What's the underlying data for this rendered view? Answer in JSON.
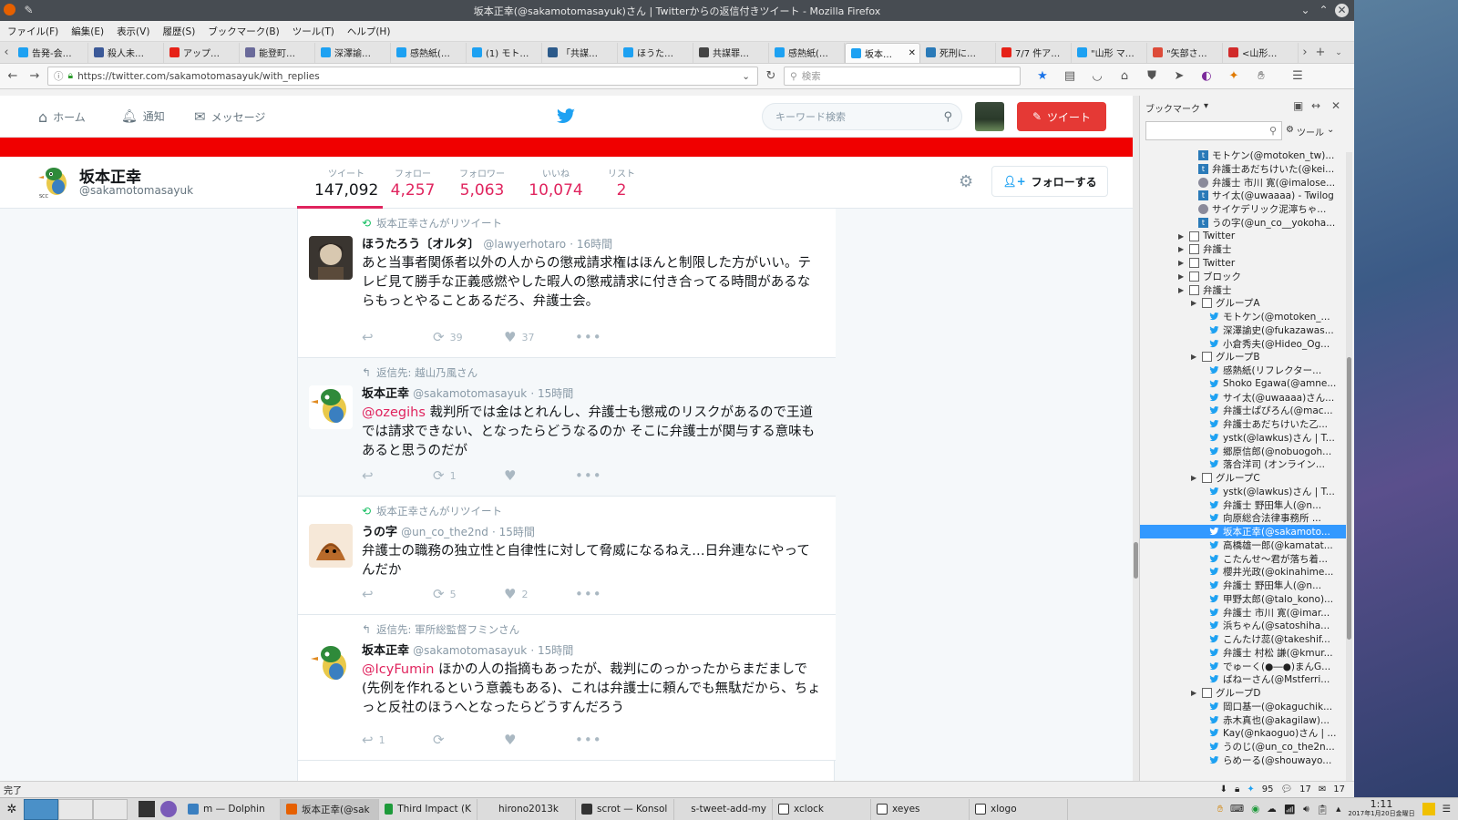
{
  "window": {
    "title": "坂本正幸(@sakamotomasayuk)さん | Twitterからの返信付きツイート - Mozilla Firefox"
  },
  "menu": [
    "ファイル(F)",
    "編集(E)",
    "表示(V)",
    "履歴(S)",
    "ブックマーク(B)",
    "ツール(T)",
    "ヘルプ(H)"
  ],
  "tabs": [
    {
      "label": "告発-会…",
      "icon": "twitter-icon",
      "color": "#1da1f2"
    },
    {
      "label": "殺人未…",
      "icon": "facebook-icon",
      "color": "#3b5998"
    },
    {
      "label": "アップ…",
      "icon": "youtube-icon",
      "color": "#e62117"
    },
    {
      "label": "能登町…",
      "icon": "globe-icon",
      "color": "#6a6a9a"
    },
    {
      "label": "深澤諭…",
      "icon": "twitter-icon",
      "color": "#1da1f2"
    },
    {
      "label": "感熱紙(…",
      "icon": "twitter-icon",
      "color": "#1da1f2"
    },
    {
      "label": "(1) モト…",
      "icon": "twitter-icon",
      "color": "#1da1f2"
    },
    {
      "label": "「共謀…",
      "icon": "arrow-icon",
      "color": "#2c5a8a"
    },
    {
      "label": "ほうた…",
      "icon": "twitter-icon",
      "color": "#1da1f2"
    },
    {
      "label": "共謀罪…",
      "icon": "spider-icon",
      "color": "#444"
    },
    {
      "label": "感熱紙(…",
      "icon": "twitter-icon",
      "color": "#1da1f2"
    },
    {
      "label": "坂本…",
      "icon": "twitter-icon",
      "color": "#1da1f2",
      "active": true
    },
    {
      "label": "死刑に…",
      "icon": "grid-icon",
      "color": "#2a7ab8"
    },
    {
      "label": "7/7 件ア…",
      "icon": "youtube-icon",
      "color": "#e62117"
    },
    {
      "label": "\"山形 マ…",
      "icon": "twitter-icon",
      "color": "#1da1f2"
    },
    {
      "label": "\"矢部さ…",
      "icon": "google-plus-icon",
      "color": "#dd4b39"
    },
    {
      "label": "<山形…",
      "icon": "flower-icon",
      "color": "#d12a2a"
    }
  ],
  "nav": {
    "url": "https://twitter.com/sakamotomasayuk/with_replies",
    "search_placeholder": "検索"
  },
  "twitter": {
    "home": "ホーム",
    "notifications": "通知",
    "messages": "メッセージ",
    "search_placeholder": "キーワード検索",
    "tweet_button": "ツイート",
    "profile": {
      "name": "坂本正幸",
      "handle": "@sakamotomasayuk"
    },
    "stats": [
      {
        "label": "ツイート",
        "value": "147,092"
      },
      {
        "label": "フォロー",
        "value": "4,257"
      },
      {
        "label": "フォロワー",
        "value": "5,063"
      },
      {
        "label": "いいね",
        "value": "10,074"
      },
      {
        "label": "リスト",
        "value": "2"
      }
    ],
    "follow_button": "フォローする",
    "tweets": [
      {
        "context": "坂本正幸さんがリツイート",
        "ctx_icon": "retweet-icon",
        "name": "ほうたろう〔オルタ〕",
        "handle": "@lawyerhotaro",
        "time": "· 16時間",
        "mention": "",
        "text": "あと当事者関係者以外の人からの懲戒請求権はほんと制限した方がいい。テレビ見て勝手な正義感燃やした暇人の懲戒請求に付き合ってる時間があるならもっとやることあるだろ、弁護士会。",
        "reply": "",
        "rt": "39",
        "like": "37"
      },
      {
        "context": "返信先: 越山乃風さん",
        "ctx_icon": "reply-icon",
        "name": "坂本正幸",
        "handle": "@sakamotomasayuk",
        "time": "· 15時間",
        "mention": "@ozegihs",
        "text": " 裁判所では金はとれんし、弁護士も懲戒のリスクがあるので王道では請求できない、となったらどうなるのか そこに弁護士が関与する意味もあると思うのだが",
        "reply": "",
        "rt": "1",
        "like": ""
      },
      {
        "context": "坂本正幸さんがリツイート",
        "ctx_icon": "retweet-icon",
        "name": "うの字",
        "handle": "@un_co_the2nd",
        "time": "· 15時間",
        "mention": "",
        "text": "弁護士の職務の独立性と自律性に対して脅威になるねえ…日弁連なにやってんだか",
        "reply": "",
        "rt": "5",
        "like": "2"
      },
      {
        "context": "返信先: 軍所総監督フミンさん",
        "ctx_icon": "reply-icon",
        "name": "坂本正幸",
        "handle": "@sakamotomasayuk",
        "time": "· 15時間",
        "mention": "@IcyFumin",
        "text": " ほかの人の指摘もあったが、裁判にのっかったからまだましで(先例を作れるという意義もある)、これは弁護士に頼んでも無駄だから、ちょっと反社のほうへとなったらどうすんだろう",
        "reply": "1",
        "rt": "",
        "like": ""
      }
    ]
  },
  "sidebar": {
    "title": "ブックマーク",
    "tools": "ツール",
    "items": [
      {
        "label": "モトケン(@motoken_tw)...",
        "indent": 0,
        "type": "tw2"
      },
      {
        "label": "弁護士あだちけいた(@kei...",
        "indent": 0,
        "type": "tw2"
      },
      {
        "label": "弁護士 市川 寛(@imalose...",
        "indent": 0,
        "type": "globe"
      },
      {
        "label": "サイ太(@uwaaaa) - Twilog",
        "indent": 0,
        "type": "tw2"
      },
      {
        "label": "サイケデリック泥濘ちゃ...",
        "indent": 0,
        "type": "globe"
      },
      {
        "label": "うの字(@un_co__yokoha...",
        "indent": 0,
        "type": "tw2"
      },
      {
        "label": "Twitter",
        "indent": -1,
        "type": "folder"
      },
      {
        "label": "弁護士",
        "indent": -1,
        "type": "folder"
      },
      {
        "label": "Twitter",
        "indent": -1,
        "type": "folder"
      },
      {
        "label": "ブロック",
        "indent": -1,
        "type": "folder"
      },
      {
        "label": "弁護士",
        "indent": -1,
        "type": "folderopen"
      },
      {
        "label": "グループA",
        "indent": 1,
        "type": "folder"
      },
      {
        "label": "モトケン(@motoken_...",
        "indent": 2,
        "type": "tw"
      },
      {
        "label": "深澤諭史(@fukazawas...",
        "indent": 2,
        "type": "tw"
      },
      {
        "label": "小倉秀夫(@Hideo_Og...",
        "indent": 2,
        "type": "tw"
      },
      {
        "label": "グループB",
        "indent": 1,
        "type": "folder"
      },
      {
        "label": "感熱紙(リフレクター...",
        "indent": 2,
        "type": "tw"
      },
      {
        "label": "Shoko Egawa(@amne...",
        "indent": 2,
        "type": "tw"
      },
      {
        "label": "サイ太(@uwaaaa)さん...",
        "indent": 2,
        "type": "tw"
      },
      {
        "label": "弁護士ぱぴろん(@mac...",
        "indent": 2,
        "type": "tw"
      },
      {
        "label": "弁護士あだちけいた乙...",
        "indent": 2,
        "type": "tw"
      },
      {
        "label": "ystk(@lawkus)さん | T...",
        "indent": 2,
        "type": "tw"
      },
      {
        "label": "郷原信郎(@nobuogoh...",
        "indent": 2,
        "type": "tw"
      },
      {
        "label": "落合洋司 (オンライン...",
        "indent": 2,
        "type": "tw"
      },
      {
        "label": "グループC",
        "indent": 1,
        "type": "folder"
      },
      {
        "label": "ystk(@lawkus)さん | T...",
        "indent": 2,
        "type": "tw"
      },
      {
        "label": "弁護士 野田隼人(@n...",
        "indent": 2,
        "type": "tw"
      },
      {
        "label": "向原総合法律事務所 ...",
        "indent": 2,
        "type": "tw"
      },
      {
        "label": "坂本正幸(@sakamoto...",
        "indent": 2,
        "type": "tw",
        "selected": true
      },
      {
        "label": "高橋雄一郎(@kamatat...",
        "indent": 2,
        "type": "tw"
      },
      {
        "label": "こたんせ～君が落ち着...",
        "indent": 2,
        "type": "tw"
      },
      {
        "label": "櫻井光政(@okinahime...",
        "indent": 2,
        "type": "tw"
      },
      {
        "label": "弁護士 野田隼人(@n...",
        "indent": 2,
        "type": "tw"
      },
      {
        "label": "甲野太郎(@talo_kono)...",
        "indent": 2,
        "type": "tw"
      },
      {
        "label": "弁護士 市川 寛(@imar...",
        "indent": 2,
        "type": "tw"
      },
      {
        "label": "浜ちゃん(@satoshiha...",
        "indent": 2,
        "type": "tw"
      },
      {
        "label": "こんたけ蕊(@takeshif...",
        "indent": 2,
        "type": "tw"
      },
      {
        "label": "弁護士 村松 謙(@kmur...",
        "indent": 2,
        "type": "tw"
      },
      {
        "label": "でゅーく(●―●)まんG...",
        "indent": 2,
        "type": "tw"
      },
      {
        "label": "ばねーさん(@Mstferri...",
        "indent": 2,
        "type": "tw"
      },
      {
        "label": "グループD",
        "indent": 1,
        "type": "folder"
      },
      {
        "label": "岡口基一(@okaguchik...",
        "indent": 2,
        "type": "tw"
      },
      {
        "label": "赤木真也(@akagilaw)...",
        "indent": 2,
        "type": "tw"
      },
      {
        "label": "Kay(@nkaoguo)さん | ...",
        "indent": 2,
        "type": "tw"
      },
      {
        "label": "うのじ(@un_co_the2n...",
        "indent": 2,
        "type": "tw"
      },
      {
        "label": "らめーる(@shouwayo...",
        "indent": 2,
        "type": "tw"
      }
    ]
  },
  "status": {
    "text": "完了",
    "count1": "95",
    "count2": "17",
    "count3": "17"
  },
  "taskbar": {
    "tasks": [
      "m — Dolphin",
      "坂本正幸(@sak",
      "Third Impact (K",
      "hirono2013k",
      "scrot — Konsol",
      "s-tweet-add-my",
      "xclock",
      "xeyes",
      "xlogo"
    ],
    "clock": "1:11",
    "date": "2017年1月20日金曜日"
  }
}
